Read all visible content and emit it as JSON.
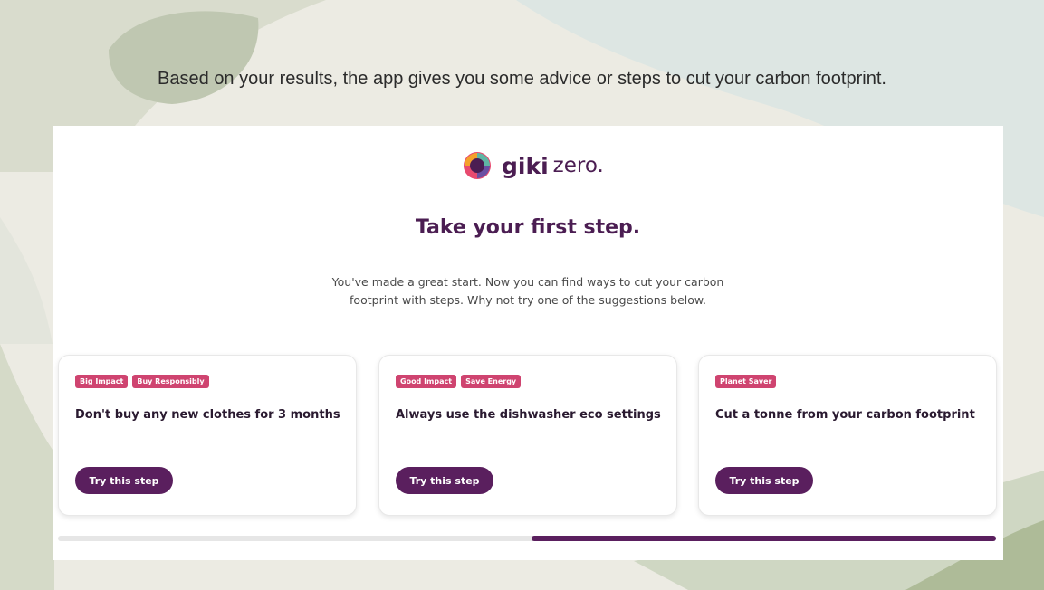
{
  "slide": {
    "caption": "Based on your results, the app gives you some advice or steps to cut your carbon footprint."
  },
  "app": {
    "logo": {
      "brand_bold": "giki",
      "brand_light": "zero."
    },
    "heading": "Take your first step.",
    "intro": "You've made a great start. Now you can find ways to cut your carbon footprint with steps. Why not try one of the suggestions below.",
    "cards": [
      {
        "tags": [
          "Big Impact",
          "Buy Responsibly"
        ],
        "title": "Don't buy any new clothes for 3 months",
        "button": "Try this step"
      },
      {
        "tags": [
          "Good Impact",
          "Save Energy"
        ],
        "title": "Always use the dishwasher eco settings",
        "button": "Try this step"
      },
      {
        "tags": [
          "Planet Saver"
        ],
        "title": "Cut a tonne from your carbon footprint",
        "button": "Try this step"
      }
    ],
    "scrollbar": {
      "start_fraction": 0.505,
      "end_fraction": 1.0
    }
  },
  "colors": {
    "brand_purple": "#4b1d52",
    "button_purple": "#5a1f5e",
    "tag_pink": "#cf4470",
    "slide_background": "#ecebe3"
  },
  "icons": {
    "logo": "giki-zero-logo-icon"
  }
}
